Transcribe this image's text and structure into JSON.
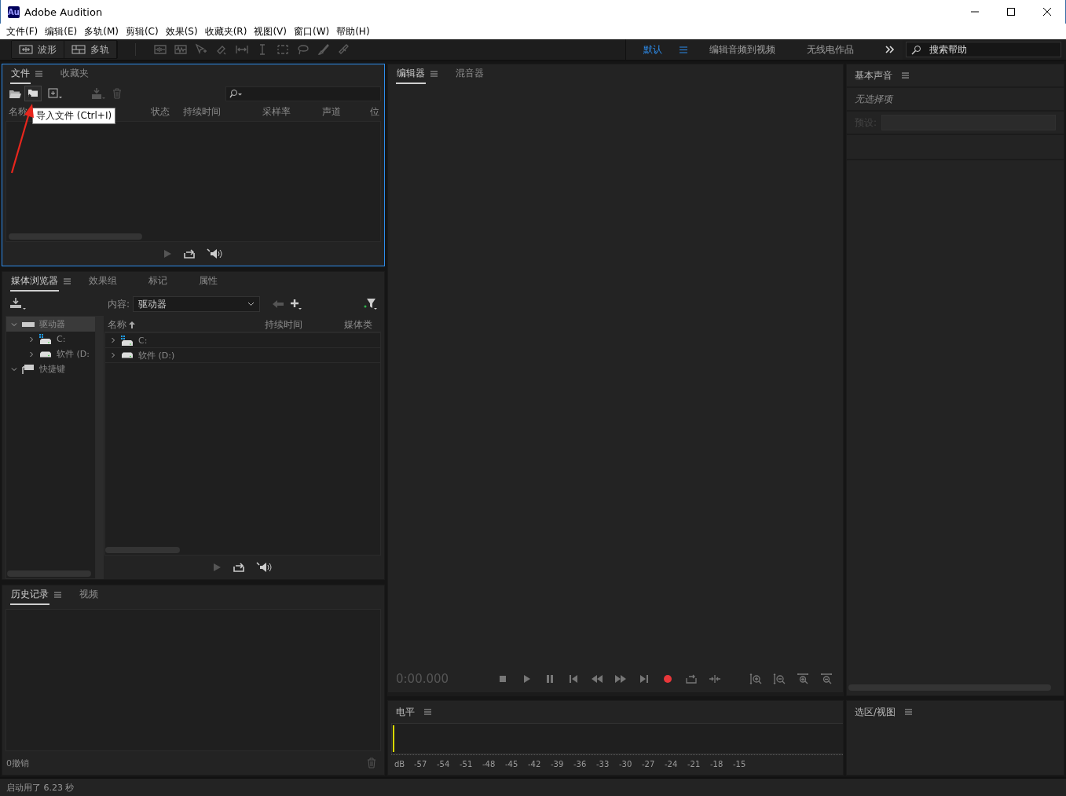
{
  "window": {
    "logo": "Au",
    "title": "Adobe Audition"
  },
  "menu": [
    "文件(F)",
    "编辑(E)",
    "多轨(M)",
    "剪辑(C)",
    "效果(S)",
    "收藏夹(R)",
    "视图(V)",
    "窗口(W)",
    "帮助(H)"
  ],
  "toolbar": {
    "modes": [
      {
        "label": "波形",
        "kind": "waveform"
      },
      {
        "label": "多轨",
        "kind": "multitrack"
      }
    ],
    "workspaces": [
      {
        "label": "默认",
        "selected": true
      },
      {
        "label": "编辑音频到视频",
        "selected": false
      },
      {
        "label": "无线电作品",
        "selected": false
      }
    ],
    "search": {
      "placeholder": "搜索帮助"
    }
  },
  "files_panel": {
    "focused": true,
    "tabs": [
      {
        "label": "文件",
        "selected": true
      },
      {
        "label": "收藏夹",
        "selected": false
      }
    ],
    "columns": [
      "名称",
      "状态",
      "持续时间",
      "采样率",
      "声道",
      "位"
    ],
    "tooltip": "导入文件 (Ctrl+I)"
  },
  "media_browser": {
    "tabs": [
      {
        "label": "媒体浏览器",
        "selected": true
      },
      {
        "label": "效果组",
        "selected": false
      },
      {
        "label": "标记",
        "selected": false
      },
      {
        "label": "属性",
        "selected": false
      }
    ],
    "content_label": "内容:",
    "content_value": "驱动器",
    "tree": [
      {
        "label": "驱动器",
        "kind": "drives",
        "expanded": true,
        "selected": true,
        "children": [
          {
            "label": "C:",
            "kind": "system-drive",
            "expanded": false,
            "selected": false
          },
          {
            "label": "软件 (D:",
            "kind": "drive",
            "expanded": false,
            "selected": false
          }
        ]
      },
      {
        "label": "快捷键",
        "kind": "shortcuts",
        "expanded": true,
        "selected": false
      }
    ],
    "columns": [
      "名称",
      "持续时间",
      "媒体类"
    ],
    "rows": [
      {
        "name": "C:",
        "kind": "system-drive"
      },
      {
        "name": "软件 (D:)",
        "kind": "drive"
      }
    ]
  },
  "history": {
    "tabs": [
      {
        "label": "历史记录",
        "selected": true
      },
      {
        "label": "视频",
        "selected": false
      }
    ],
    "undo_count": "0撤销"
  },
  "editor": {
    "tabs": [
      {
        "label": "编辑器",
        "selected": true
      },
      {
        "label": "混音器",
        "selected": false
      }
    ],
    "time": "0:00.000"
  },
  "levels": {
    "title": "电平",
    "scale": [
      "dB",
      "-57",
      "-54",
      "-51",
      "-48",
      "-45",
      "-42",
      "-39",
      "-36",
      "-33",
      "-30",
      "-27",
      "-24",
      "-21",
      "-18",
      "-15"
    ]
  },
  "basic_sound": {
    "title": "基本声音",
    "empty_text": "无选择项",
    "preset_label": "预设:"
  },
  "selection_view": {
    "title": "选区/视图"
  },
  "status": "启动用了 6.23 秒"
}
